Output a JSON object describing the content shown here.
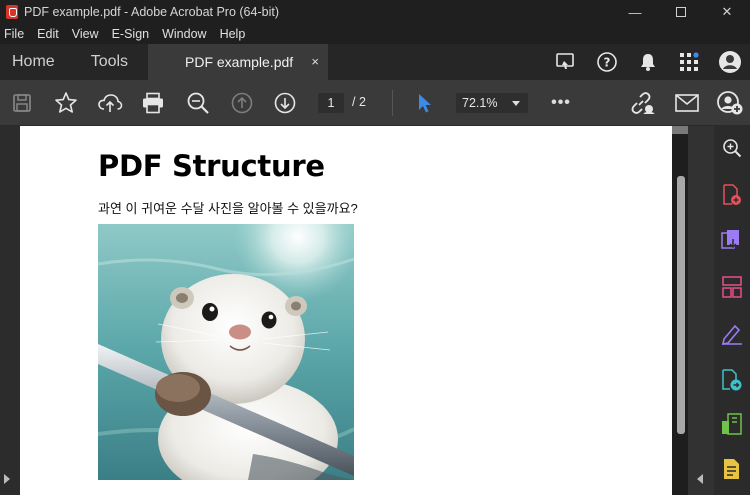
{
  "window": {
    "title": "PDF example.pdf - Adobe Acrobat Pro (64-bit)",
    "controls": [
      "minimize-icon",
      "maximize-icon",
      "close-icon"
    ]
  },
  "menu": [
    "File",
    "Edit",
    "View",
    "E-Sign",
    "Window",
    "Help"
  ],
  "nav_tabs": [
    "Home",
    "Tools"
  ],
  "doc_tab": {
    "label": "PDF example.pdf",
    "close": "×"
  },
  "tab_icons": [
    "share-review-icon",
    "help-icon",
    "notification-bell-icon",
    "apps-grid-icon",
    "user-avatar-icon"
  ],
  "toolbar": {
    "icons": [
      "save-icon",
      "bookmark-star-icon",
      "cloud-upload-icon",
      "print-icon",
      "zoom-search-icon",
      "page-up-icon",
      "page-down-icon",
      "select-cursor-icon",
      "more-icon",
      "share-link-icon",
      "email-icon",
      "add-user-icon"
    ],
    "current_page": "1",
    "total_pages": "/ 2",
    "zoom": "72.1%",
    "more": "•••"
  },
  "document": {
    "heading": "PDF Structure",
    "subtitle": "과연 이 귀여운 수달 사진을 알아볼 수 있을까요?",
    "image": "otter-photo"
  },
  "right_tools": [
    "zoom-icon",
    "create-pdf-icon",
    "export-pdf-icon",
    "organize-pages-icon",
    "fill-sign-icon",
    "combine-files-icon",
    "compress-icon",
    "comment-icon"
  ],
  "colors": {
    "accent_blue": "#3b8bea",
    "tool_red": "#e8505b",
    "tool_purple": "#9b7cf2",
    "tool_blue": "#4aa3f0",
    "tool_pink": "#e84f8a",
    "tool_teal": "#3fc1c9",
    "tool_green": "#6fc24a",
    "tool_yellow": "#e8c341"
  }
}
